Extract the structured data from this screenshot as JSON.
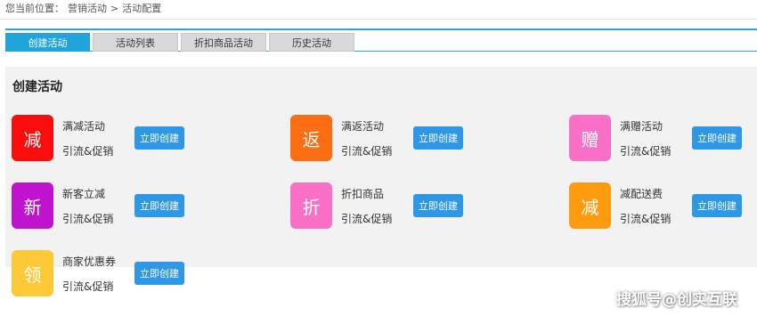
{
  "breadcrumb": {
    "prefix": "您当前位置：",
    "level1": "营销活动",
    "separator": ">",
    "level2": "活动配置"
  },
  "tabs": [
    {
      "label": "创建活动",
      "active": true
    },
    {
      "label": "活动列表",
      "active": false
    },
    {
      "label": "折扣商品活动",
      "active": false
    },
    {
      "label": "历史活动",
      "active": false
    }
  ],
  "panel": {
    "title": "创建活动",
    "items": [
      {
        "icon_char": "减",
        "color": "#fb0d0d",
        "name": "满减活动",
        "subtitle": "引流&促销",
        "button": "立即创建"
      },
      {
        "icon_char": "返",
        "color": "#fd6d13",
        "name": "满返活动",
        "subtitle": "引流&促销",
        "button": "立即创建"
      },
      {
        "icon_char": "赠",
        "color": "#fb70c7",
        "name": "满赠活动",
        "subtitle": "引流&促销",
        "button": "立即创建"
      },
      {
        "icon_char": "新",
        "color": "#c013cf",
        "name": "新客立减",
        "subtitle": "引流&促销",
        "button": "立即创建"
      },
      {
        "icon_char": "折",
        "color": "#fb70c7",
        "name": "折扣商品",
        "subtitle": "引流&促销",
        "button": "立即创建"
      },
      {
        "icon_char": "减",
        "color": "#fd9a0d",
        "name": "减配送费",
        "subtitle": "引流&促销",
        "button": "立即创建"
      },
      {
        "icon_char": "领",
        "color": "#fec937",
        "name": "商家优惠券",
        "subtitle": "引流&促销",
        "button": "立即创建"
      }
    ]
  },
  "watermark": "搜狐号@创实互联"
}
